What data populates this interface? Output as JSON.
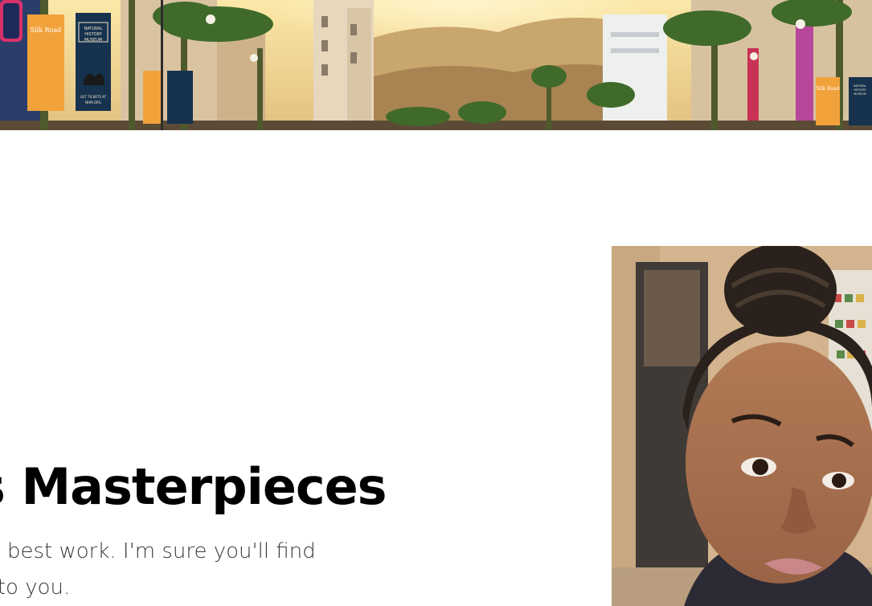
{
  "hero": {
    "image": "Hollywood street with palm trees and museum banners"
  },
  "banners": {
    "left_title_top": "NATURAL",
    "left_title_mid": "HISTORY",
    "left_title_bottom": "MUSEUM",
    "left_tickets": "GET TICKETS AT",
    "left_url": "NHM.ORG",
    "silk_road": "Silk Road",
    "right_title_top": "NATURAL",
    "right_title_mid": "HISTORY",
    "right_title_bottom": "MUSEUM"
  },
  "main": {
    "heading": "s Masterpieces",
    "intro_line1": "my best work. I'm sure you'll find",
    "intro_line2": "ks to you."
  },
  "portrait": {
    "image": "Portrait selfie of a woman"
  },
  "colors": {
    "heading": "#000000",
    "body_text": "#3a3a3a",
    "background": "#ffffff"
  }
}
